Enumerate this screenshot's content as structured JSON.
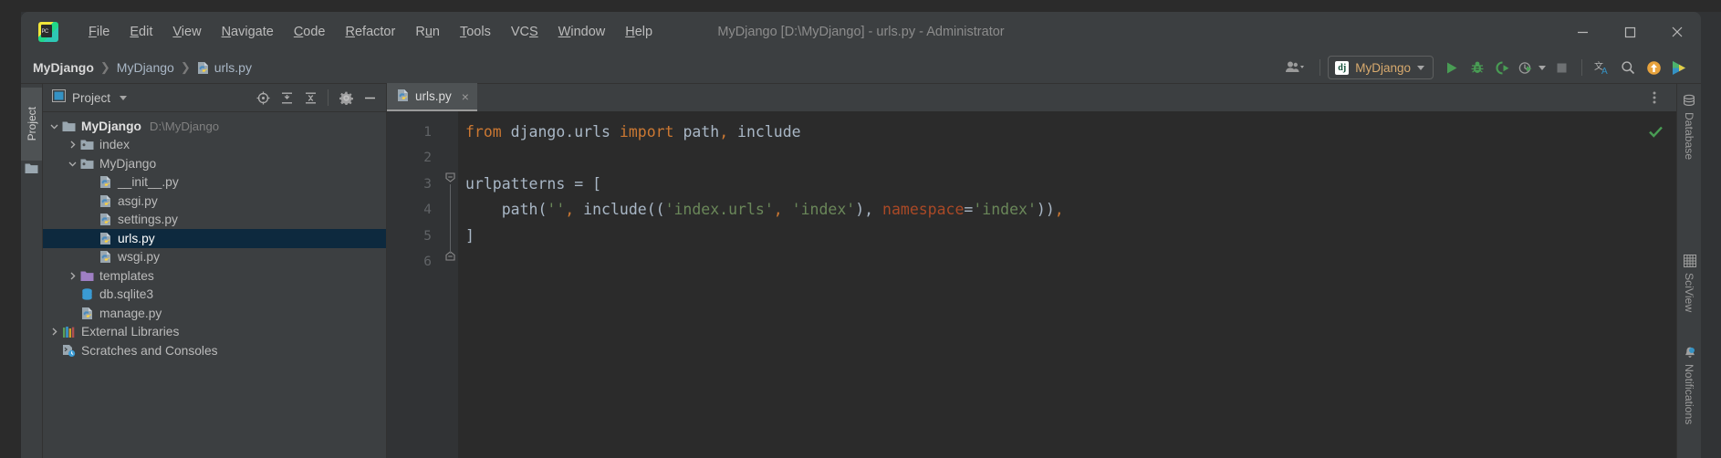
{
  "window": {
    "title": "MyDjango [D:\\MyDjango] - urls.py - Administrator",
    "minimize_label": "Minimize",
    "maximize_label": "Maximize",
    "close_label": "Close",
    "logo_text": "PC"
  },
  "menubar": {
    "items": [
      {
        "label": "File",
        "mnemonic": "F"
      },
      {
        "label": "Edit",
        "mnemonic": "E"
      },
      {
        "label": "View",
        "mnemonic": "V"
      },
      {
        "label": "Navigate",
        "mnemonic": "N"
      },
      {
        "label": "Code",
        "mnemonic": "C"
      },
      {
        "label": "Refactor",
        "mnemonic": "R"
      },
      {
        "label": "Run",
        "mnemonic": "u"
      },
      {
        "label": "Tools",
        "mnemonic": "T"
      },
      {
        "label": "VCS",
        "mnemonic": "S"
      },
      {
        "label": "Window",
        "mnemonic": "W"
      },
      {
        "label": "Help",
        "mnemonic": "H"
      }
    ]
  },
  "navbar": {
    "breadcrumb": [
      "MyDjango",
      "MyDjango",
      "urls.py"
    ],
    "run_config": {
      "label": "MyDjango",
      "badge": "dj"
    },
    "buttons": [
      {
        "name": "run-button",
        "title": "Run 'MyDjango'"
      },
      {
        "name": "debug-button",
        "title": "Debug 'MyDjango'"
      },
      {
        "name": "run-coverage-button",
        "title": "Run with Coverage"
      },
      {
        "name": "profile-button",
        "title": "Profile"
      },
      {
        "name": "stop-button",
        "title": "Stop"
      },
      {
        "name": "translate-button",
        "title": "Translate"
      },
      {
        "name": "search-everywhere-button",
        "title": "Search Everywhere"
      },
      {
        "name": "update-project-button",
        "title": "Update Project"
      },
      {
        "name": "ide-features-button",
        "title": "IDE Features Trainer"
      }
    ],
    "user_icon_title": "Settings Sync / Account"
  },
  "left_stripe": {
    "tab_label": "Project"
  },
  "project_panel": {
    "title": "Project",
    "header_buttons": [
      {
        "name": "select-opened-file-button",
        "title": "Select Opened File"
      },
      {
        "name": "expand-all-button",
        "title": "Expand All"
      },
      {
        "name": "collapse-all-button",
        "title": "Collapse All"
      },
      {
        "name": "panel-settings-button",
        "title": "Options"
      },
      {
        "name": "hide-panel-button",
        "title": "Hide"
      }
    ],
    "tree": [
      {
        "label": "MyDjango",
        "sub": "D:\\MyDjango",
        "indent": 0,
        "arrow": "down",
        "icon": "folder-root",
        "bold": true,
        "selected": false
      },
      {
        "label": "index",
        "sub": "",
        "indent": 1,
        "arrow": "right",
        "icon": "folder-module",
        "bold": false,
        "selected": false
      },
      {
        "label": "MyDjango",
        "sub": "",
        "indent": 1,
        "arrow": "down",
        "icon": "folder-module",
        "bold": false,
        "selected": false
      },
      {
        "label": "__init__.py",
        "sub": "",
        "indent": 2,
        "arrow": "none",
        "icon": "python-file",
        "bold": false,
        "selected": false
      },
      {
        "label": "asgi.py",
        "sub": "",
        "indent": 2,
        "arrow": "none",
        "icon": "python-file",
        "bold": false,
        "selected": false
      },
      {
        "label": "settings.py",
        "sub": "",
        "indent": 2,
        "arrow": "none",
        "icon": "python-file",
        "bold": false,
        "selected": false
      },
      {
        "label": "urls.py",
        "sub": "",
        "indent": 2,
        "arrow": "none",
        "icon": "python-file",
        "bold": false,
        "selected": true
      },
      {
        "label": "wsgi.py",
        "sub": "",
        "indent": 2,
        "arrow": "none",
        "icon": "python-file",
        "bold": false,
        "selected": false
      },
      {
        "label": "templates",
        "sub": "",
        "indent": 1,
        "arrow": "right",
        "icon": "folder-templates",
        "bold": false,
        "selected": false
      },
      {
        "label": "db.sqlite3",
        "sub": "",
        "indent": 1,
        "arrow": "none",
        "icon": "database-file",
        "bold": false,
        "selected": false
      },
      {
        "label": "manage.py",
        "sub": "",
        "indent": 1,
        "arrow": "none",
        "icon": "python-file",
        "bold": false,
        "selected": false
      },
      {
        "label": "External Libraries",
        "sub": "",
        "indent": 0,
        "arrow": "right",
        "icon": "libraries",
        "bold": false,
        "selected": false
      },
      {
        "label": "Scratches and Consoles",
        "sub": "",
        "indent": 0,
        "arrow": "none",
        "icon": "scratches",
        "bold": false,
        "selected": false
      }
    ]
  },
  "editor": {
    "tab": {
      "label": "urls.py",
      "close_label": "×"
    },
    "more_options_title": "More",
    "inspection_status": "No problems found",
    "line_numbers": [
      "1",
      "2",
      "3",
      "4",
      "5",
      "6"
    ],
    "lines": [
      [
        {
          "t": "from ",
          "c": "kw"
        },
        {
          "t": "django.urls ",
          "c": "plain"
        },
        {
          "t": "import ",
          "c": "kw"
        },
        {
          "t": "path",
          "c": "plain"
        },
        {
          "t": ",",
          "c": "comma"
        },
        {
          "t": " include",
          "c": "plain"
        }
      ],
      [],
      [
        {
          "t": "urlpatterns = [",
          "c": "plain"
        }
      ],
      [
        {
          "t": "    path(",
          "c": "plain"
        },
        {
          "t": "''",
          "c": "str"
        },
        {
          "t": ",",
          "c": "comma"
        },
        {
          "t": " include((",
          "c": "plain"
        },
        {
          "t": "'index.urls'",
          "c": "str"
        },
        {
          "t": ",",
          "c": "comma"
        },
        {
          "t": " ",
          "c": "plain"
        },
        {
          "t": "'index'",
          "c": "str"
        },
        {
          "t": "),",
          "c": "plain"
        },
        {
          "t": " namespace",
          "c": "named"
        },
        {
          "t": "=",
          "c": "plain"
        },
        {
          "t": "'index'",
          "c": "str"
        },
        {
          "t": "))",
          "c": "plain"
        },
        {
          "t": ",",
          "c": "comma"
        }
      ],
      [
        {
          "t": "]",
          "c": "brk"
        }
      ],
      []
    ]
  },
  "right_stripe": {
    "tabs": [
      {
        "label": "Database",
        "icon": "database-icon",
        "badge": false
      },
      {
        "label": "SciView",
        "icon": "grid-icon",
        "badge": false
      },
      {
        "label": "Notifications",
        "icon": "bell-icon",
        "badge": true
      }
    ]
  },
  "colors": {
    "bg_window": "#3c3f41",
    "bg_editor": "#2b2b2b",
    "bg_gutter": "#313335",
    "selection": "#0d293e",
    "accent_green": "#499c54",
    "accent_orange": "#cc7832",
    "string_green": "#6a8759",
    "text": "#a9b7c6"
  }
}
